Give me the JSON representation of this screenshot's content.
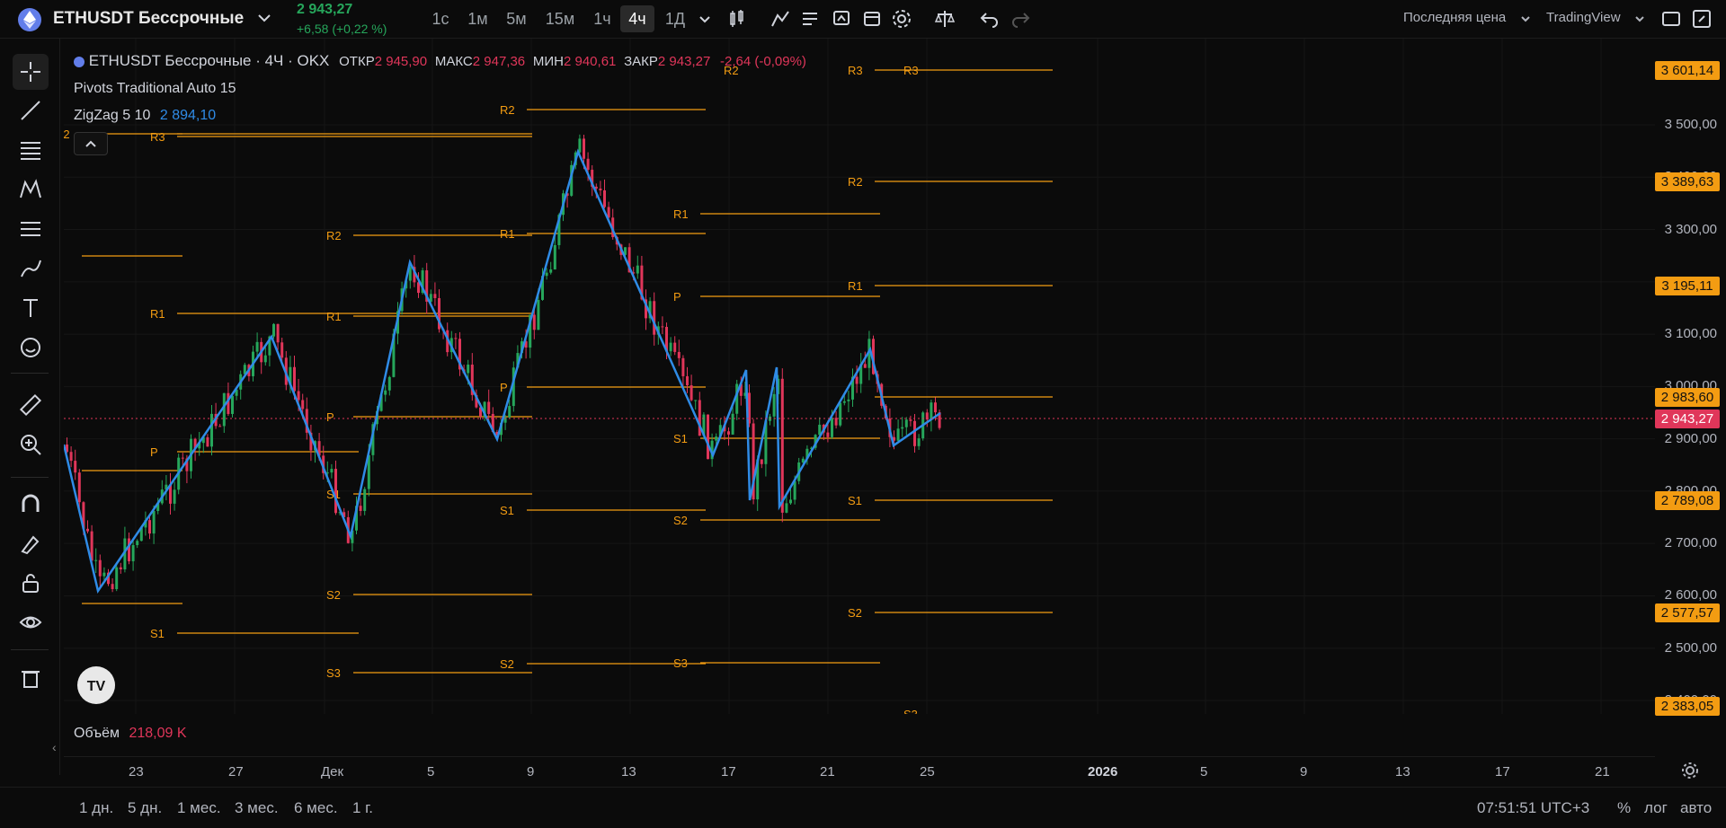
{
  "symbol": {
    "name": "ETHUSDT Бессрочные",
    "price": "2 943,27",
    "change": "+6,58 (+0,22 %)"
  },
  "timeframes": [
    "1с",
    "1м",
    "5м",
    "15м",
    "1ч",
    "4ч",
    "1Д"
  ],
  "active_timeframe": "4ч",
  "topright": {
    "price_type": "Последняя цена",
    "tv": "TradingView"
  },
  "legend": {
    "title": "ETHUSDT Бессрочные · 4Ч · OKX",
    "open_label": "ОТКР",
    "open": "2 945,90",
    "high_label": "МАКС",
    "high": "2 947,36",
    "low_label": "МИН",
    "low": "2 940,61",
    "close_label": "ЗАКР",
    "close": "2 943,27",
    "change": "-2,64 (-0,09%)",
    "pivots": "Pivots Traditional Auto 15",
    "zigzag": "ZigZag 5 10",
    "zigzag_value": "2 894,10"
  },
  "volume": {
    "label": "Объём",
    "value": "218,09 K"
  },
  "y_ticks": [
    "3 500,00",
    "3 400,00",
    "3 300,00",
    "3 200,00",
    "3 100,00",
    "3 000,00",
    "2 900,00",
    "2 800,00",
    "2 700,00",
    "2 600,00",
    "2 500,00",
    "2 400,00"
  ],
  "y_tags": [
    {
      "label": "3 601,14",
      "color": "#f39c12"
    },
    {
      "label": "3 389,63",
      "color": "#f39c12"
    },
    {
      "label": "3 195,11",
      "color": "#f39c12"
    },
    {
      "label": "2 983,60",
      "color": "#f39c12"
    },
    {
      "label": "2 943,27",
      "color": "#e0365a"
    },
    {
      "label": "2 789,08",
      "color": "#f39c12"
    },
    {
      "label": "2 577,57",
      "color": "#f39c12"
    },
    {
      "label": "2 383,05",
      "color": "#f39c12"
    }
  ],
  "x_ticks": [
    "23",
    "27",
    "Дек",
    "5",
    "9",
    "13",
    "17",
    "21",
    "25",
    "2026",
    "5",
    "9",
    "13",
    "17",
    "21"
  ],
  "bottom": {
    "ranges": [
      "1 дн.",
      "5 дн.",
      "1 мес.",
      "3 мес.",
      "6 мес.",
      "1 г."
    ],
    "time": "07:51:51 UTC+3",
    "percent": "%",
    "log": "лог",
    "auto": "авто"
  },
  "pivot_labels": [
    "R2",
    "R3",
    "R1",
    "P",
    "S1",
    "S2",
    "S3"
  ],
  "colors": {
    "up": "#26a65b",
    "down": "#e0365a",
    "pivot": "#f39c12",
    "zigzag": "#2f8be6"
  }
}
